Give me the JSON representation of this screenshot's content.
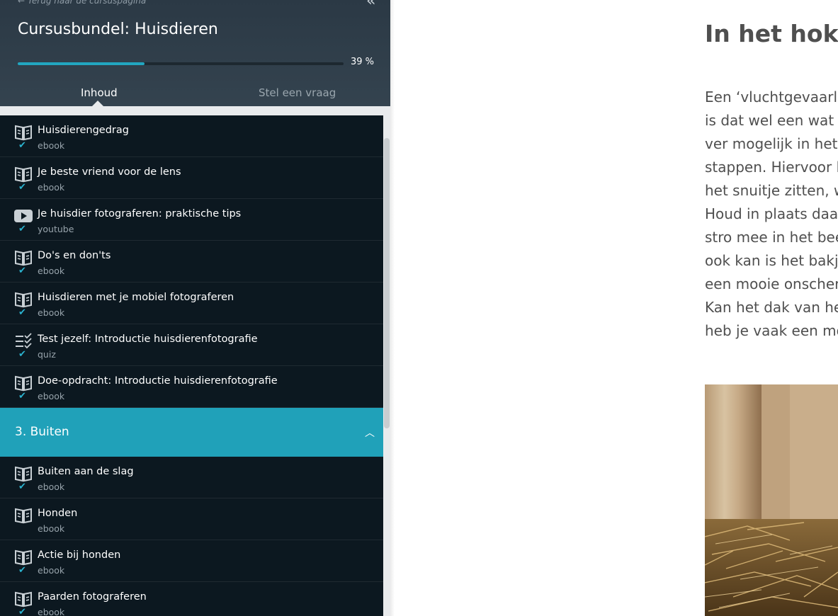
{
  "sidebar": {
    "back_link": "Terug naar de cursuspagina",
    "course_title": "Cursusbundel: Huisdieren",
    "progress_percent": 39,
    "progress_label": "39 %",
    "tabs": [
      {
        "label": "Inhoud",
        "active": true
      },
      {
        "label": "Stel een vraag",
        "active": false
      }
    ],
    "items": [
      {
        "title": "Huisdierengedrag",
        "type": "ebook",
        "icon": "book-icon",
        "completed": true
      },
      {
        "title": "Je beste vriend voor de lens",
        "type": "ebook",
        "icon": "book-icon",
        "completed": true
      },
      {
        "title": "Je huisdier fotograferen: praktische tips",
        "type": "youtube",
        "icon": "play-icon",
        "completed": true
      },
      {
        "title": "Do's en don'ts",
        "type": "ebook",
        "icon": "book-icon",
        "completed": true
      },
      {
        "title": "Huisdieren met je mobiel fotograferen",
        "type": "ebook",
        "icon": "book-icon",
        "completed": true
      },
      {
        "title": "Test jezelf: Introductie huisdierenfotografie",
        "type": "quiz",
        "icon": "quiz-icon",
        "completed": true
      },
      {
        "title": "Doe-opdracht: Introductie huisdierenfotografie",
        "type": "ebook",
        "icon": "book-icon",
        "completed": true
      }
    ],
    "section": {
      "label": "3. Buiten",
      "expanded": true
    },
    "section_items": [
      {
        "title": "Buiten aan de slag",
        "type": "ebook",
        "icon": "book-icon",
        "completed": true
      },
      {
        "title": "Honden",
        "type": "ebook",
        "icon": "book-icon",
        "completed": false
      },
      {
        "title": "Actie bij honden",
        "type": "ebook",
        "icon": "book-icon",
        "completed": true
      },
      {
        "title": "Paarden fotograferen",
        "type": "ebook",
        "icon": "book-icon",
        "completed": true
      }
    ],
    "accent_color": "#20a1b9"
  },
  "main": {
    "title": "In het hok",
    "paragraph_lines": [
      "Een ‘vluchtgevaarlij",
      "is dat wel een wat n",
      "ver mogelijk in het l",
      "stappen. Hiervoor h",
      "het snuitje zitten, w",
      "Houd in plaats daar",
      "stro mee in het bee",
      "ook kan is het bakje",
      "een mooie onscher",
      "Kan het dak van het",
      "heb je vaak een mo"
    ]
  }
}
